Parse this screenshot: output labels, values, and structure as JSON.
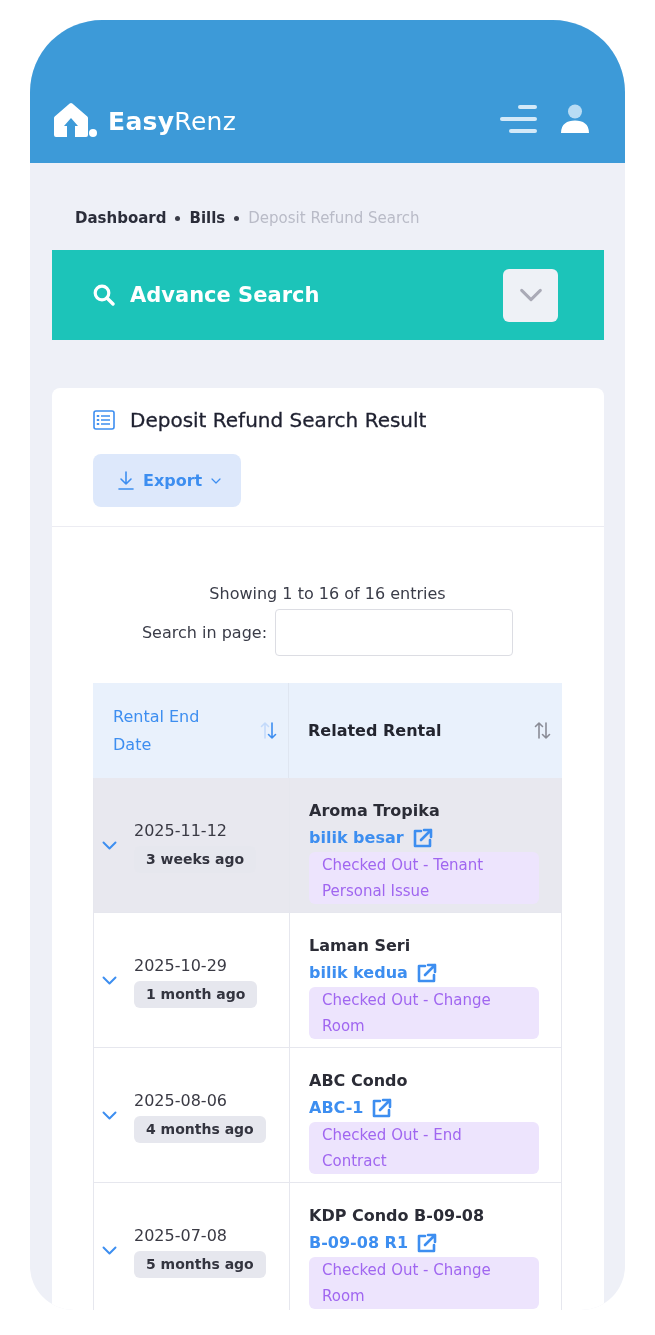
{
  "header": {
    "logo": "**Easy**Renz"
  },
  "breadcrumb": [
    {
      "label": "Dashboard",
      "current": false
    },
    {
      "label": "Bills",
      "current": false
    },
    {
      "label": "Deposit Refund Search",
      "current": true
    }
  ],
  "advance_search": {
    "title": "Advance Search",
    "expanded": false
  },
  "results": {
    "title": "Deposit Refund Search Result",
    "export_button": "Export",
    "entries_info": "Showing 1 to 16 of 16 entries",
    "search": {
      "label": "Search in page:"
    }
  },
  "table": {
    "columns": [
      {
        "label": "Rental End Date",
        "sorted": true
      },
      {
        "label": "Related Rental",
        "sorted": false
      }
    ],
    "rows": [
      {
        "date": "2025-11-12",
        "relative": "3 weeks ago",
        "property": "Aroma Tropika",
        "unit": "bilik besar",
        "status": "Checked Out - Tenant Personal Issue",
        "selected": true,
        "expanded": false
      },
      {
        "date": "2025-10-29",
        "relative": "1 month ago",
        "property": "Laman Seri",
        "unit": "bilik kedua",
        "status": "Checked Out - Change Room",
        "selected": false,
        "expanded": false
      },
      {
        "date": "2025-08-06",
        "relative": "4 months ago",
        "property": "ABC Condo",
        "unit": "ABC-1",
        "status": "Checked Out - End Contract",
        "selected": false,
        "expanded": false
      },
      {
        "date": "2025-07-08",
        "relative": "5 months ago",
        "property": "KDP Condo B-09-08",
        "unit": "B-09-08 R1",
        "status": "Checked Out - Change Room",
        "selected": false,
        "expanded": false
      }
    ]
  }
}
